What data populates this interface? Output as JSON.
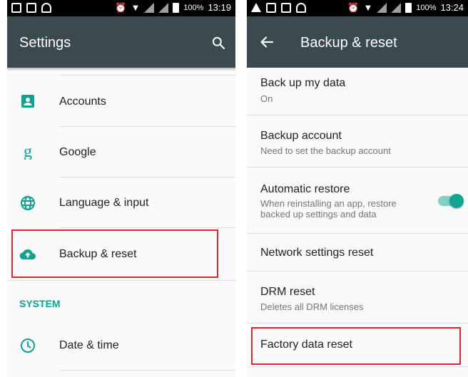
{
  "left": {
    "status_bar": {
      "battery_text": "100%",
      "time": "13:19"
    },
    "app_bar": {
      "title": "Settings",
      "search_icon": "search-icon"
    },
    "items": [
      {
        "label": "Accounts",
        "icon": "account-box-icon"
      },
      {
        "label": "Google",
        "icon": "google-g-icon"
      },
      {
        "label": "Language & input",
        "icon": "globe-icon"
      },
      {
        "label": "Backup & reset",
        "icon": "cloud-upload-icon"
      }
    ],
    "section_header": "SYSTEM",
    "system_items": [
      {
        "label": "Date & time",
        "icon": "clock-icon"
      }
    ]
  },
  "right": {
    "status_bar": {
      "battery_text": "100%",
      "time": "13:24"
    },
    "app_bar": {
      "title": "Backup & reset",
      "back_icon": "arrow-back-icon"
    },
    "items": [
      {
        "title": "Back up my data",
        "subtitle": "On"
      },
      {
        "title": "Backup account",
        "subtitle": "Need to set the backup account"
      },
      {
        "title": "Automatic restore",
        "subtitle": "When reinstalling an app, restore backed up settings and data",
        "toggle_on": true
      },
      {
        "title": "Network settings reset"
      },
      {
        "title": "DRM reset",
        "subtitle": "Deletes all DRM licenses"
      },
      {
        "title": "Factory data reset"
      }
    ]
  },
  "colors": {
    "app_bar": "#3b4a4f",
    "accent": "#0aa394",
    "highlight": "#e3242b"
  }
}
